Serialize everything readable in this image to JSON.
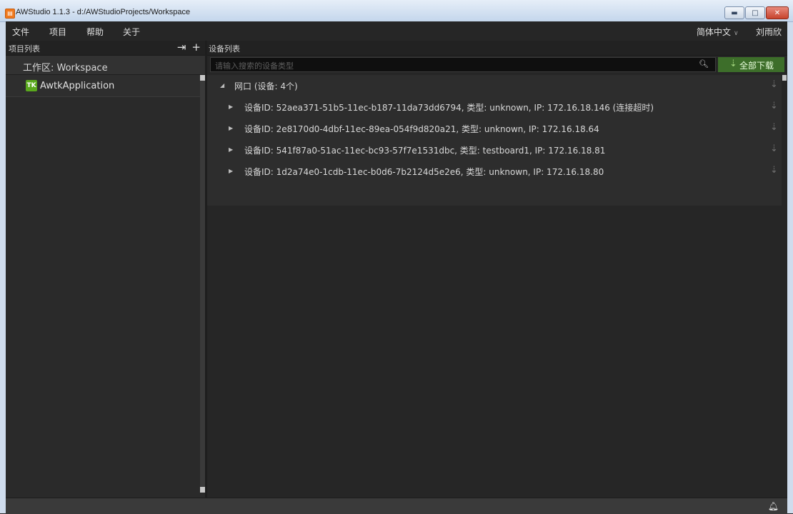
{
  "window": {
    "title": "AWStudio 1.1.3 - d:/AWStudioProjects/Workspace",
    "app_icon": "awstudio-app-icon",
    "controls": {
      "minimize": "▭",
      "maximize": "□",
      "close": "✕"
    }
  },
  "menu": {
    "items": [
      {
        "label": "文件"
      },
      {
        "label": "项目"
      },
      {
        "label": "帮助"
      },
      {
        "label": "关于"
      }
    ],
    "language": "简体中文",
    "user": "刘雨欣"
  },
  "left_panel": {
    "title": "项目列表",
    "import_icon": "import-icon",
    "add_icon": "add-icon",
    "workspace_label": "工作区: Workspace",
    "project": {
      "badge": "TK",
      "name": "AwtkApplication"
    }
  },
  "right_panel": {
    "title": "设备列表",
    "search_placeholder": "请输入搜索的设备类型",
    "download_all_label": "全部下载",
    "group_label": "网口 (设备: 4个)",
    "devices": [
      {
        "text": "设备ID: 52aea371-51b5-11ec-b187-11da73dd6794, 类型: unknown, IP: 172.16.18.146 (连接超时)"
      },
      {
        "text": "设备ID: 2e8170d0-4dbf-11ec-89ea-054f9d820a21, 类型: unknown, IP: 172.16.18.64"
      },
      {
        "text": "设备ID: 541f87a0-51ac-11ec-bc93-57f7e1531dbc, 类型: testboard1, IP: 172.16.18.81"
      },
      {
        "text": "设备ID: 1d2a74e0-1cdb-11ec-b0d6-7b2124d5e2e6, 类型: unknown, IP: 172.16.18.80"
      }
    ]
  },
  "colors": {
    "accent_green": "#3d6e2a",
    "tk_badge": "#5aa81d",
    "background": "#2b2b2b"
  }
}
